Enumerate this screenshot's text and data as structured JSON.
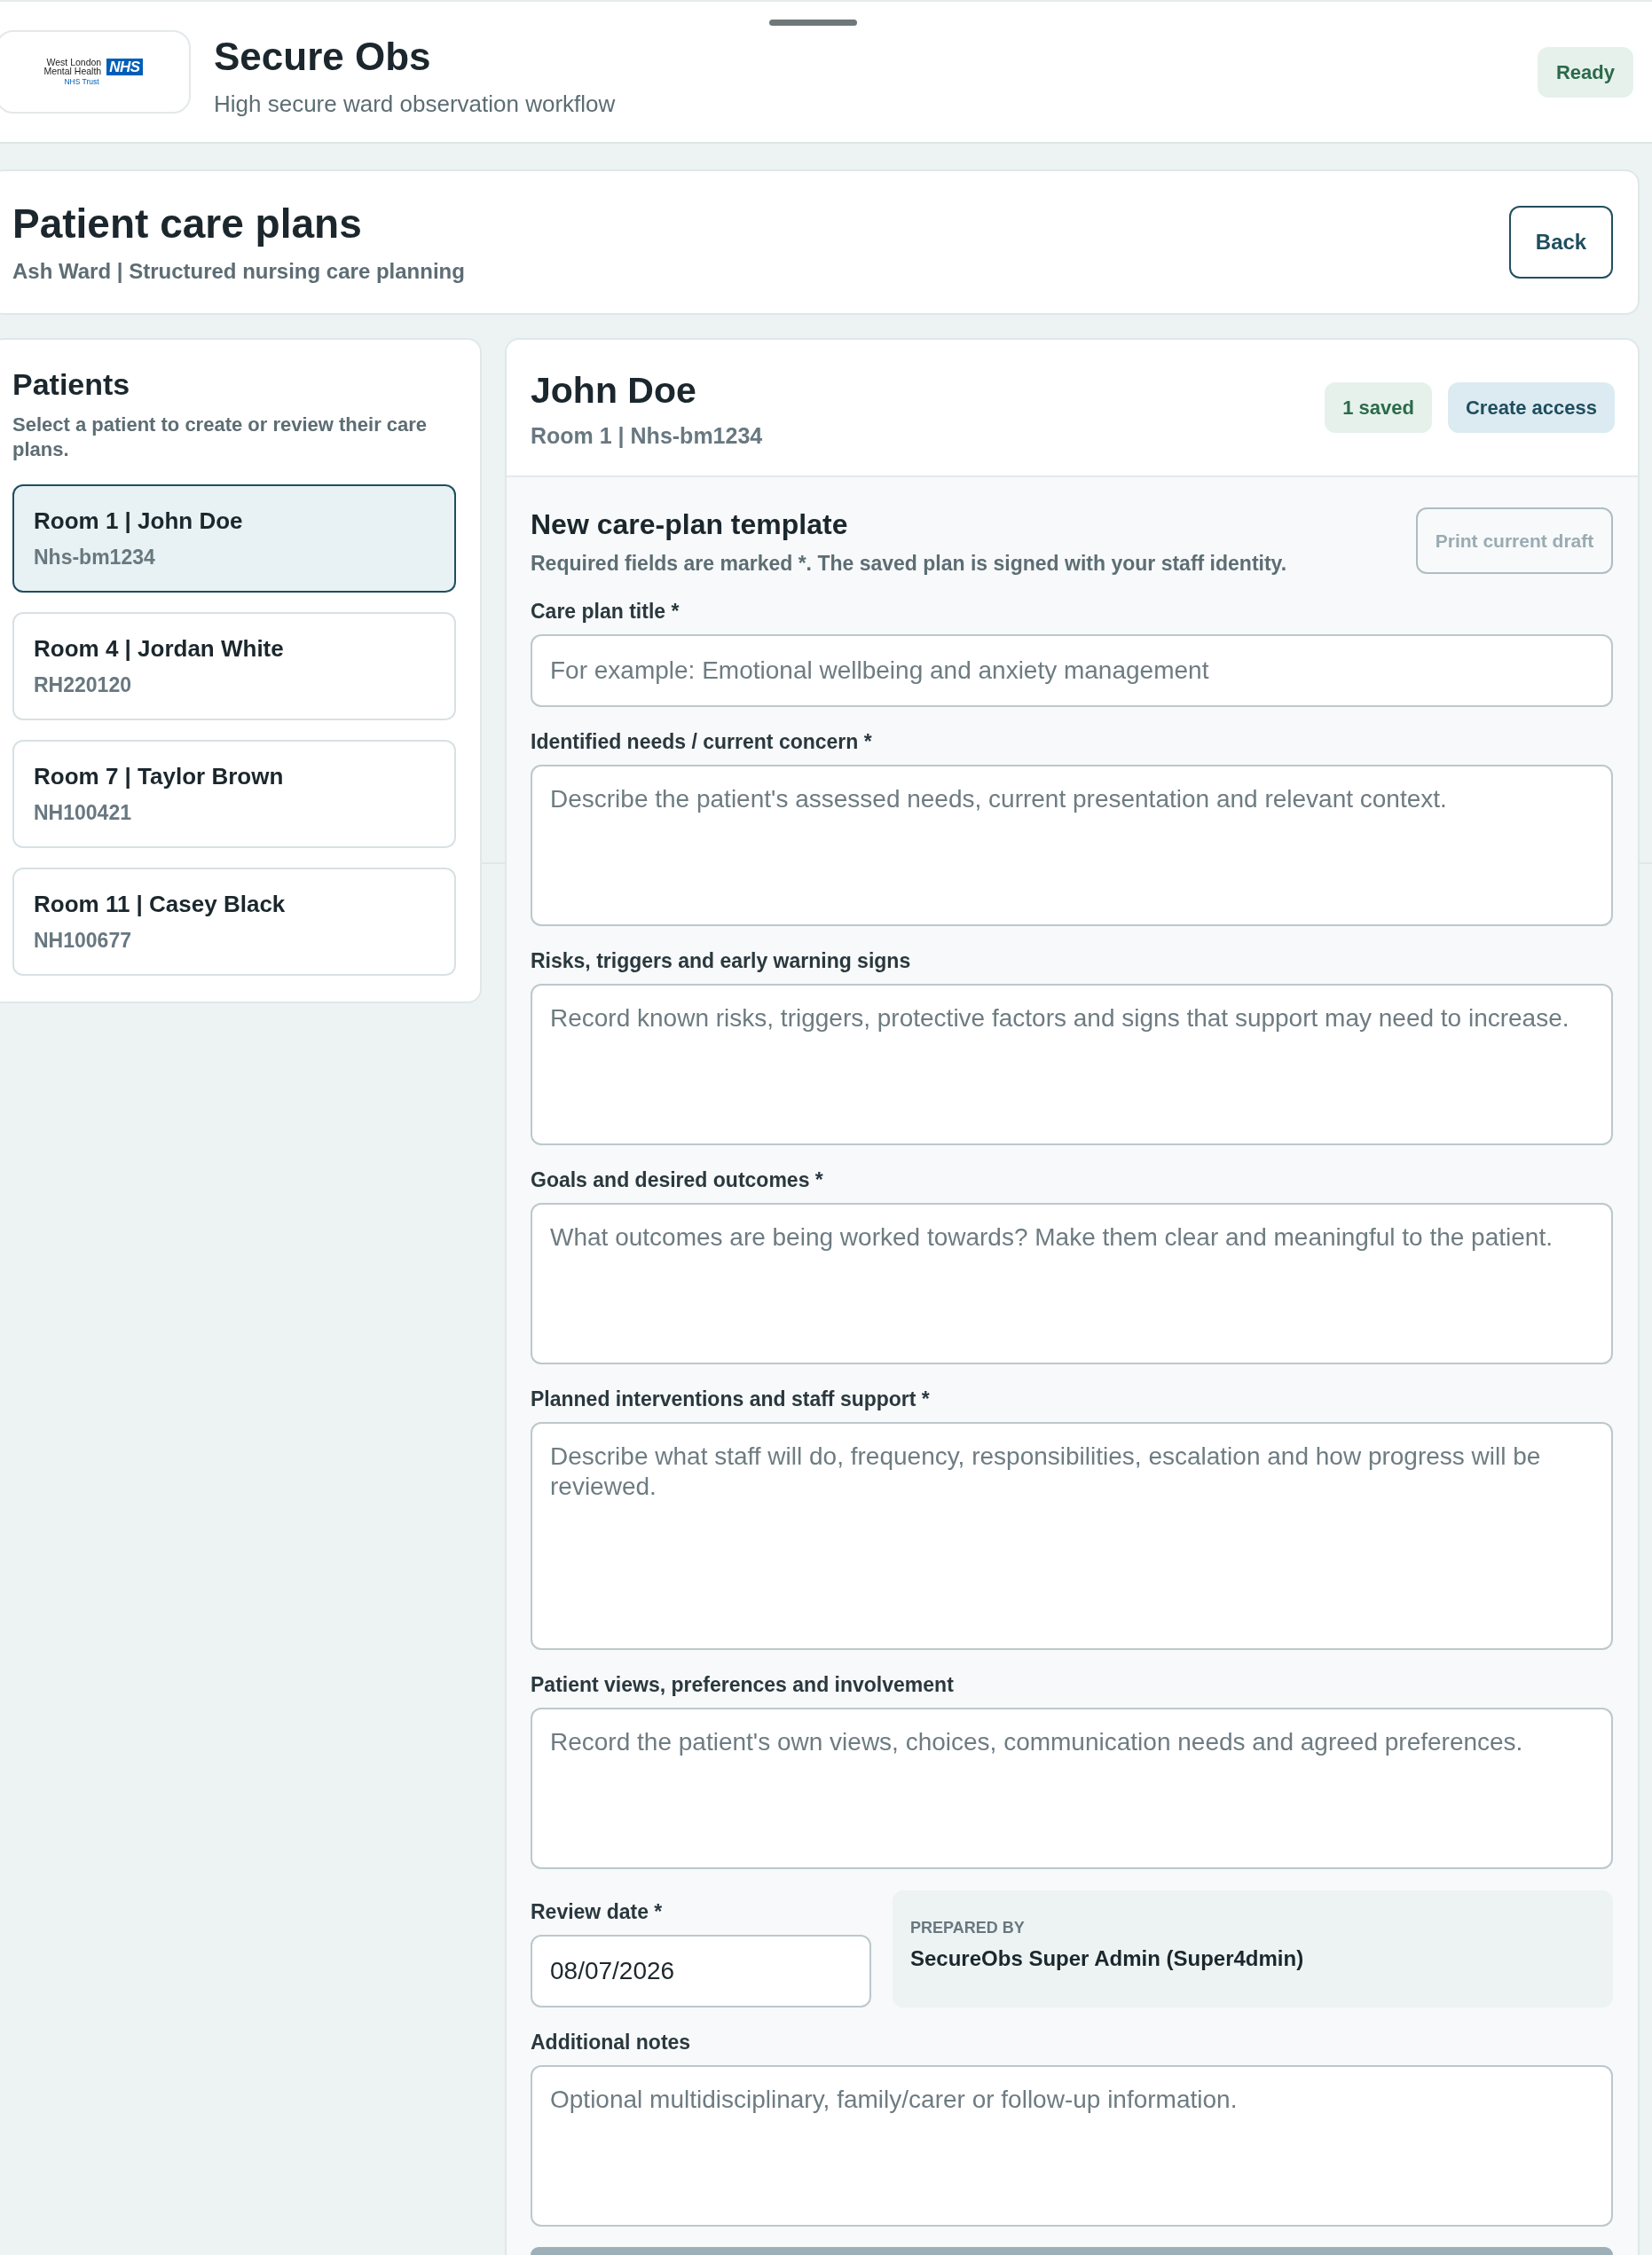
{
  "header": {
    "logo": {
      "lines": [
        "West London",
        "Mental Health"
      ],
      "mark": "NHS",
      "trust": "NHS Trust"
    },
    "title": "Secure Obs",
    "subtitle": "High secure ward observation workflow",
    "status": "Ready"
  },
  "page": {
    "title": "Patient care plans",
    "subtitle": "Ash Ward | Structured nursing care planning",
    "back_button": "Back"
  },
  "patients": {
    "title": "Patients",
    "hint": "Select a patient to create or review their care plans.",
    "items": [
      {
        "label": "Room 1 | John Doe",
        "reference": "Nhs-bm1234",
        "selected": true
      },
      {
        "label": "Room 4 | Jordan White",
        "reference": "RH220120",
        "selected": false
      },
      {
        "label": "Room 7 | Taylor Brown",
        "reference": "NH100421",
        "selected": false
      },
      {
        "label": "Room 11 | Casey Black",
        "reference": "NH100677",
        "selected": false
      }
    ]
  },
  "patient": {
    "name": "John Doe",
    "details": "Room 1 | Nhs-bm1234",
    "saved_badge": "1 saved",
    "access_button": "Create access"
  },
  "form": {
    "title": "New care-plan template",
    "note": "Required fields are marked *. The saved plan is signed with your staff identity.",
    "print_button": {
      "label": "Print current draft",
      "disabled": true
    },
    "fields": [
      {
        "kind": "input",
        "label": "Care plan title *",
        "placeholder": "For example: Emotional wellbeing and anxiety management"
      },
      {
        "kind": "textarea",
        "label": "Identified needs / current concern *",
        "placeholder": "Describe the patient's assessed needs, current presentation and relevant context."
      },
      {
        "kind": "textarea",
        "label": "Risks, triggers and early warning signs",
        "placeholder": "Record known risks, triggers, protective factors and signs that support may need to increase."
      },
      {
        "kind": "textarea",
        "label": "Goals and desired outcomes *",
        "placeholder": "What outcomes are being worked towards? Make them clear and meaningful to the patient."
      },
      {
        "kind": "largetextarea",
        "label": "Planned interventions and staff support *",
        "placeholder": "Describe what staff will do, frequency, responsibilities, escalation and how progress will be reviewed."
      },
      {
        "kind": "textarea",
        "label": "Patient views, preferences and involvement",
        "placeholder": "Record the patient's own views, choices, communication needs and agreed preferences."
      }
    ],
    "review_date": {
      "label": "Review date *",
      "value": "08/07/2026"
    },
    "prepared_by": {
      "label": "PREPARED BY",
      "value": "SecureObs Super Admin (Super4dmin)"
    },
    "notes": {
      "label": "Additional notes",
      "placeholder": "Optional multidisciplinary, family/carer or follow-up information."
    }
  }
}
